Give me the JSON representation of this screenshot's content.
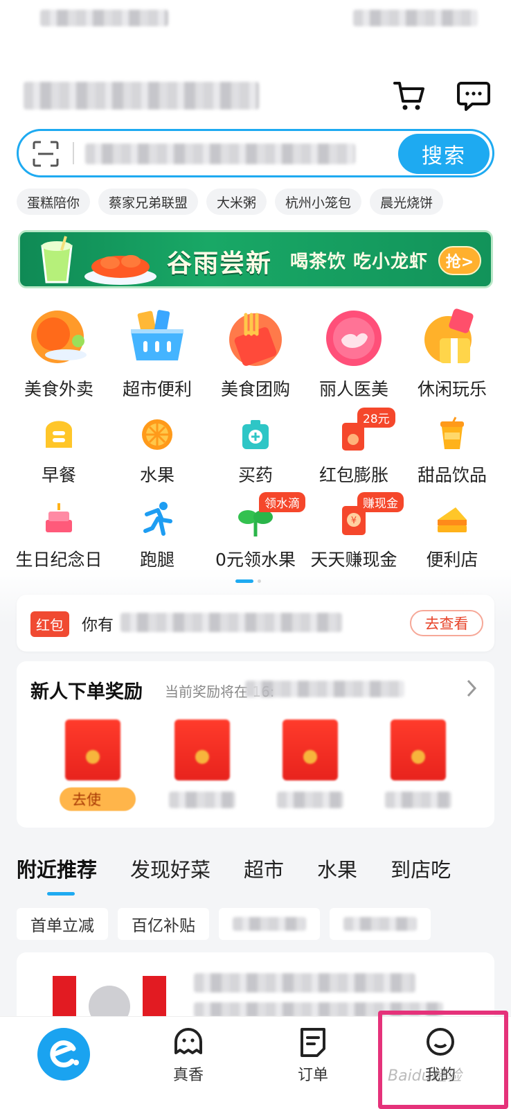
{
  "colors": {
    "accent": "#1EAAF1",
    "red": "#F04A32",
    "banner_green": "#19A866",
    "highlight": "#E5327A"
  },
  "header": {
    "search_button": "搜索",
    "icons": [
      "scan-icon",
      "cart-icon",
      "message-icon"
    ]
  },
  "hot_tags": [
    "蛋糕陪你",
    "蔡家兄弟联盟",
    "大米粥",
    "杭州小笼包",
    "晨光烧饼"
  ],
  "banner": {
    "title": "谷雨尝新",
    "subtitle": "喝茶饮 吃小龙虾",
    "button": "抢>"
  },
  "big_categories": [
    {
      "label": "美食外卖",
      "icon": "food-delivery-icon"
    },
    {
      "label": "超市便利",
      "icon": "supermarket-basket-icon"
    },
    {
      "label": "美食团购",
      "icon": "group-buy-icon"
    },
    {
      "label": "丽人医美",
      "icon": "beauty-icon"
    },
    {
      "label": "休闲玩乐",
      "icon": "leisure-icon"
    }
  ],
  "small_categories_row1": [
    {
      "label": "早餐",
      "icon": "bread-icon",
      "badge": ""
    },
    {
      "label": "水果",
      "icon": "orange-icon",
      "badge": ""
    },
    {
      "label": "买药",
      "icon": "medicine-kit-icon",
      "badge": ""
    },
    {
      "label": "红包膨胀",
      "icon": "red-packet-icon",
      "badge": "28元"
    },
    {
      "label": "甜品饮品",
      "icon": "drink-cup-icon",
      "badge": ""
    }
  ],
  "small_categories_row2": [
    {
      "label": "生日纪念日",
      "icon": "cake-icon",
      "badge": ""
    },
    {
      "label": "跑腿",
      "icon": "runner-icon",
      "badge": ""
    },
    {
      "label": "0元领水果",
      "icon": "sprout-icon",
      "badge": "领水滴"
    },
    {
      "label": "天天赚现金",
      "icon": "cash-icon",
      "badge": "赚现金"
    },
    {
      "label": "便利店",
      "icon": "sandwich-icon",
      "badge": ""
    }
  ],
  "notice": {
    "tag": "红包",
    "text": "你有",
    "button": "去查看"
  },
  "new_user": {
    "title": "新人下单奖励",
    "subtitle": "当前奖励将在 16:",
    "first_button": "去使"
  },
  "feed_tabs": [
    "附近推荐",
    "发现好菜",
    "超市",
    "水果",
    "到店吃"
  ],
  "filter_chips": [
    "首单立减",
    "百亿补贴"
  ],
  "bottom_nav": [
    {
      "label": "",
      "icon": "eleme-home-icon"
    },
    {
      "label": "真香",
      "icon": "ghost-face-icon"
    },
    {
      "label": "订单",
      "icon": "order-list-icon"
    },
    {
      "label": "我的",
      "icon": "profile-face-icon"
    }
  ],
  "watermark": "Baidu经验"
}
